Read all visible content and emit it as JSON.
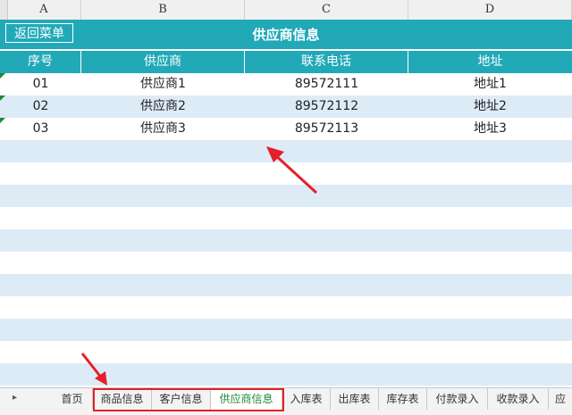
{
  "columns": [
    "A",
    "B",
    "C",
    "D"
  ],
  "back_button": "返回菜单",
  "title": "供应商信息",
  "headers": [
    "序号",
    "供应商",
    "联系电话",
    "地址"
  ],
  "rows": [
    [
      "01",
      "供应商1",
      "89572111",
      "地址1"
    ],
    [
      "02",
      "供应商2",
      "89572112",
      "地址2"
    ],
    [
      "03",
      "供应商3",
      "89572113",
      "地址3"
    ]
  ],
  "sheet_tabs": [
    "首页",
    "商品信息",
    "客户信息",
    "供应商信息",
    "入库表",
    "出库表",
    "库存表",
    "付款录入",
    "收款录入",
    "应"
  ],
  "active_tab": "供应商信息",
  "colors": {
    "accent": "#21a9b8",
    "band": "#ddebf7",
    "highlight": "#e5202a",
    "active_tab_text": "#1f8a3c"
  }
}
